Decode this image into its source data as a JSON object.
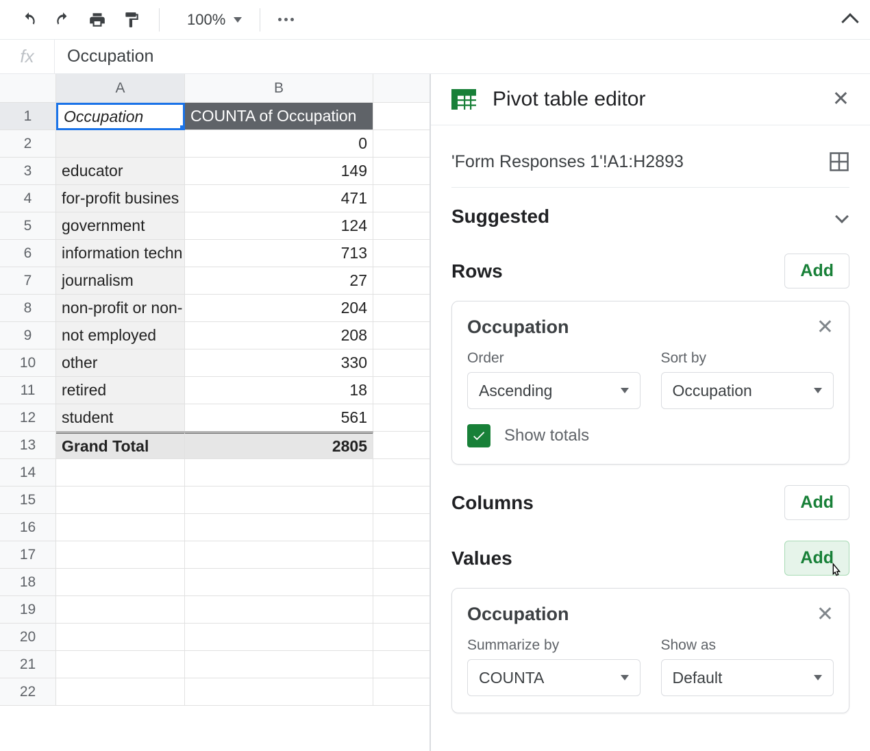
{
  "toolbar": {
    "zoom": "100%"
  },
  "formula_bar": {
    "value": "Occupation"
  },
  "columns": [
    "A",
    "B",
    ""
  ],
  "pivot": {
    "header_a": "Occupation",
    "header_b": "COUNTA of Occupation",
    "rows": [
      {
        "label": "",
        "value": "0"
      },
      {
        "label": "educator",
        "value": "149"
      },
      {
        "label": "for-profit busines",
        "value": "471"
      },
      {
        "label": "government",
        "value": "124"
      },
      {
        "label": "information techn",
        "value": "713"
      },
      {
        "label": "journalism",
        "value": "27"
      },
      {
        "label": "non-profit or non-",
        "value": "204"
      },
      {
        "label": "not employed",
        "value": "208"
      },
      {
        "label": "other",
        "value": "330"
      },
      {
        "label": "retired",
        "value": "18"
      },
      {
        "label": "student",
        "value": "561"
      }
    ],
    "grand_total_label": "Grand Total",
    "grand_total_value": "2805"
  },
  "row_numbers": [
    "1",
    "2",
    "3",
    "4",
    "5",
    "6",
    "7",
    "8",
    "9",
    "10",
    "11",
    "12",
    "13",
    "14",
    "15",
    "16",
    "17",
    "18",
    "19",
    "20",
    "21",
    "22"
  ],
  "editor": {
    "title": "Pivot table editor",
    "source": "'Form Responses 1'!A1:H2893",
    "suggested_label": "Suggested",
    "rows_label": "Rows",
    "columns_label": "Columns",
    "values_label": "Values",
    "add_label": "Add",
    "row_card": {
      "title": "Occupation",
      "order_label": "Order",
      "order_value": "Ascending",
      "sortby_label": "Sort by",
      "sortby_value": "Occupation",
      "show_totals_label": "Show totals"
    },
    "value_card": {
      "title": "Occupation",
      "summarize_label": "Summarize by",
      "summarize_value": "COUNTA",
      "showas_label": "Show as",
      "showas_value": "Default"
    }
  }
}
